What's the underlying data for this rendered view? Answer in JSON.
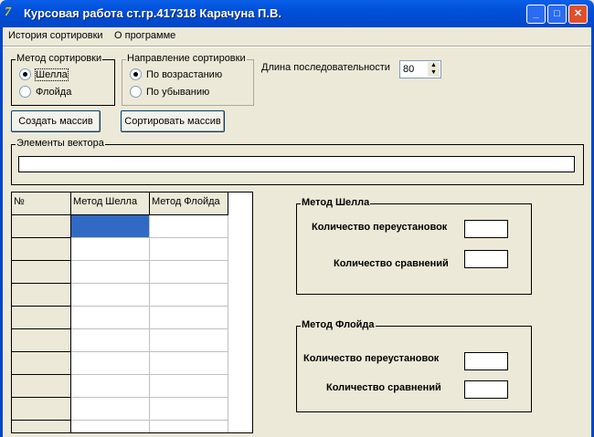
{
  "window": {
    "title": "Курсовая работа ст.гр.417318 Карачуна П.В.",
    "minimize": "_",
    "maximize": "□",
    "close": "✕"
  },
  "menu": [
    "История сортировки",
    "О программе"
  ],
  "sort_method": {
    "label": "Метод сортировки",
    "options": [
      "Шелла",
      "Флойда"
    ],
    "selected": "Шелла"
  },
  "sort_direction": {
    "label": "Направление сортировки",
    "options": [
      "По возрастанию",
      "По убыванию"
    ],
    "selected": "По возрастанию"
  },
  "length": {
    "label": "Длина последовательности",
    "value": "80"
  },
  "buttons": {
    "create": "Создать массив",
    "sort": "Сортировать массив"
  },
  "vector": {
    "label": "Элементы вектора",
    "value": ""
  },
  "grid": {
    "headers": [
      "№",
      "Метод Шелла",
      "Метод Флойда"
    ]
  },
  "shell_stats": {
    "label": "Метод Шелла",
    "swaps_label": "Количество переустановок",
    "compares_label": "Количество сравнений",
    "swaps": "",
    "compares": ""
  },
  "floyd_stats": {
    "label": "Метод Флойда",
    "swaps_label": "Количество переустановок",
    "compares_label": "Количество сравнений",
    "swaps": "",
    "compares": ""
  }
}
